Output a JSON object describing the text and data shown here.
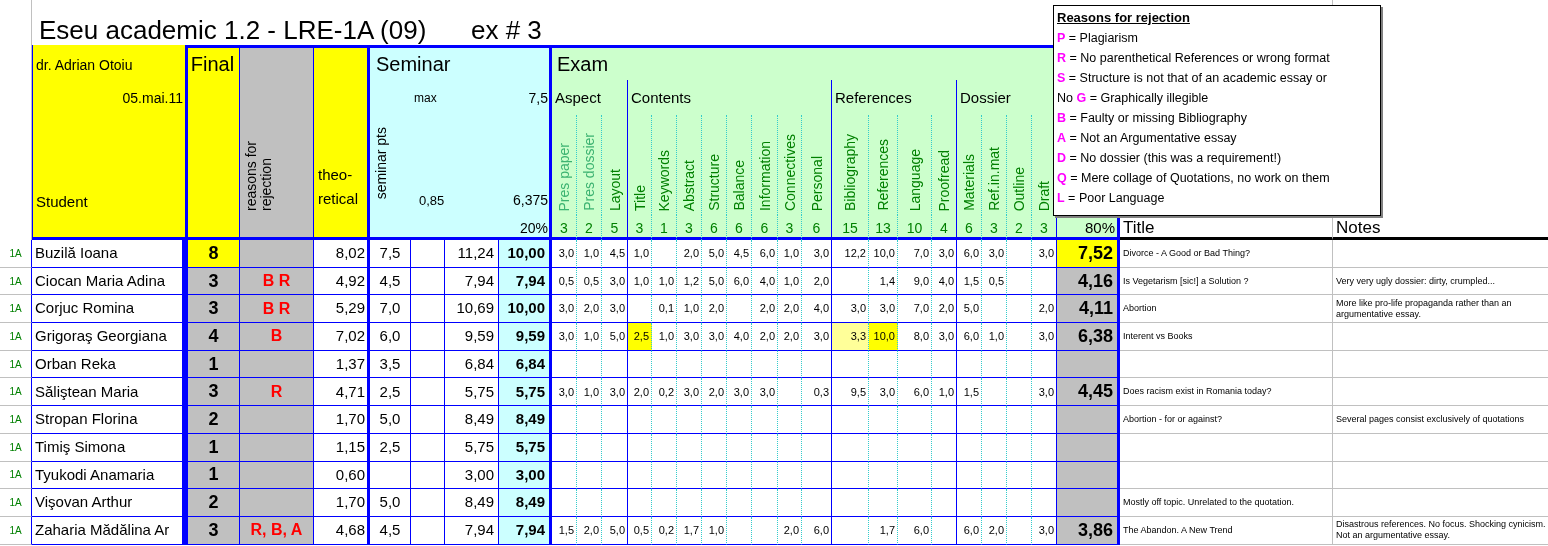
{
  "title": "Eseu academic 1.2 - LRE-1A (09)",
  "exercise": "ex # 3",
  "header": {
    "teacher": "dr. Adrian Otoiu",
    "date": "05.mai.11",
    "student_label": "Student",
    "final_label": "Final",
    "reasons_label": "reasons for rejection",
    "theoretical_label": "theo-retical",
    "title_label": "Title",
    "notes_label": "Notes"
  },
  "seminar": {
    "label": "Seminar",
    "max_label": "max",
    "max": "7,5",
    "pts_label": "seminar pts",
    "factor": "0,85",
    "total": "6,375",
    "weight": "20%"
  },
  "exam": {
    "label": "Exam",
    "weight": "80%",
    "groups": [
      {
        "label": "Aspect",
        "columns": [
          {
            "label": "Pres paper",
            "weight": "3",
            "muted": true
          },
          {
            "label": "Pres dossier",
            "weight": "2",
            "muted": true
          },
          {
            "label": "Layout",
            "weight": "5",
            "muted": false
          }
        ]
      },
      {
        "label": "Contents",
        "columns": [
          {
            "label": "Title",
            "weight": "3",
            "muted": false
          },
          {
            "label": "Keywords",
            "weight": "1",
            "muted": false
          },
          {
            "label": "Abstract",
            "weight": "3",
            "muted": false
          },
          {
            "label": "Structure",
            "weight": "6",
            "muted": false
          },
          {
            "label": "Balance",
            "weight": "6",
            "muted": false
          },
          {
            "label": "Information",
            "weight": "6",
            "muted": false
          },
          {
            "label": "Connectives",
            "weight": "3",
            "muted": false
          },
          {
            "label": "Personal",
            "weight": "6",
            "muted": false
          }
        ]
      },
      {
        "label": "References",
        "columns": [
          {
            "label": "Bibliography",
            "weight": "15",
            "muted": false
          },
          {
            "label": "References",
            "weight": "13",
            "muted": false
          },
          {
            "label": "Language",
            "weight": "10",
            "muted": false
          },
          {
            "label": "Proofread",
            "weight": "4",
            "muted": false
          }
        ]
      },
      {
        "label": "Dossier",
        "columns": [
          {
            "label": "Materials",
            "weight": "6",
            "muted": false
          },
          {
            "label": "Ref.in.mat",
            "weight": "3",
            "muted": false
          },
          {
            "label": "Outline",
            "weight": "2",
            "muted": false
          },
          {
            "label": "Draft",
            "weight": "3",
            "muted": false
          }
        ]
      }
    ]
  },
  "legend": {
    "title": "Reasons for rejection",
    "items": [
      {
        "letter": "P",
        "text": "= Plagiarism"
      },
      {
        "letter": "R",
        "text": "= No parenthetical References or wrong format"
      },
      {
        "letter": "S",
        "text": "= Structure is not that of an academic essay or"
      },
      {
        "prefix": "No",
        "letter": "G",
        "text": "= Graphically illegible"
      },
      {
        "letter": "B",
        "text": "= Faulty or missing Bibliography"
      },
      {
        "letter": "A",
        "text": "= Not an Argumentative essay"
      },
      {
        "letter": "D",
        "text": "= No dossier (this was a requirement!)"
      },
      {
        "letter": "Q",
        "text": "= Mere collage of Quotations, no work on them"
      },
      {
        "letter": "L",
        "text": "= Poor Language"
      }
    ]
  },
  "rows": [
    {
      "group": "1A",
      "name": "Buzilă Ioana",
      "final": "8",
      "passed": true,
      "theoretical": "8,02",
      "seminar_pts": "7,5",
      "seminar_sum": "11,24",
      "seminar": "10,00",
      "exam": [
        {
          "kind": "score",
          "text": "3,0"
        },
        {
          "kind": "score",
          "text": "1,0"
        },
        {
          "kind": "score",
          "text": "4,5"
        },
        {
          "kind": "score",
          "text": "1,0"
        },
        {
          "kind": "blank"
        },
        {
          "kind": "score",
          "text": "2,0"
        },
        {
          "kind": "score",
          "text": "5,0"
        },
        {
          "kind": "score",
          "text": "4,5"
        },
        {
          "kind": "score",
          "text": "6,0"
        },
        {
          "kind": "score",
          "text": "1,0"
        },
        {
          "kind": "score",
          "text": "3,0"
        },
        {
          "kind": "score",
          "text": "12,2"
        },
        {
          "kind": "score",
          "text": "10,0"
        },
        {
          "kind": "score",
          "text": "7,0"
        },
        {
          "kind": "score",
          "text": "3,0"
        },
        {
          "kind": "score",
          "text": "6,0"
        },
        {
          "kind": "score",
          "text": "3,0"
        },
        {
          "kind": "blank"
        },
        {
          "kind": "score",
          "text": "3,0"
        }
      ],
      "total": "7,52",
      "title": "Divorce - A Good or Bad Thing?"
    },
    {
      "group": "1A",
      "name": "Ciocan Maria Adina",
      "final": "3",
      "passed": false,
      "reasons": "B R",
      "theoretical": "4,92",
      "seminar_pts": "4,5",
      "seminar_sum": "7,94",
      "seminar": "7,94",
      "exam": [
        {
          "kind": "score",
          "text": "0,5"
        },
        {
          "kind": "score",
          "text": "0,5"
        },
        {
          "kind": "score",
          "text": "3,0"
        },
        {
          "kind": "score",
          "text": "1,0"
        },
        {
          "kind": "score",
          "text": "1,0"
        },
        {
          "kind": "score",
          "text": "1,2"
        },
        {
          "kind": "score",
          "text": "5,0"
        },
        {
          "kind": "score",
          "text": "6,0"
        },
        {
          "kind": "score",
          "text": "4,0"
        },
        {
          "kind": "score",
          "text": "1,0"
        },
        {
          "kind": "score",
          "text": "2,0"
        },
        {
          "kind": "blank"
        },
        {
          "kind": "score",
          "text": "1,4"
        },
        {
          "kind": "score",
          "text": "9,0"
        },
        {
          "kind": "score",
          "text": "4,0"
        },
        {
          "kind": "score",
          "text": "1,5"
        },
        {
          "kind": "score",
          "text": "0,5"
        },
        {
          "kind": "blank"
        },
        {
          "kind": "blank"
        }
      ],
      "total": "4,16",
      "title": "Is Vegetarism [sic!] a Solution ?",
      "notes": "Very very ugly dossier: dirty, crumpled..."
    },
    {
      "group": "1A",
      "name": "Corjuc Romina",
      "final": "3",
      "passed": false,
      "reasons": "B R",
      "theoretical": "5,29",
      "seminar_pts": "7,0",
      "seminar_sum": "10,69",
      "seminar": "10,00",
      "exam": [
        {
          "kind": "score",
          "text": "3,0"
        },
        {
          "kind": "score",
          "text": "2,0"
        },
        {
          "kind": "score",
          "text": "3,0"
        },
        {
          "kind": "blank"
        },
        {
          "kind": "score",
          "text": "0,1"
        },
        {
          "kind": "score",
          "text": "1,0"
        },
        {
          "kind": "score",
          "text": "2,0"
        },
        {
          "kind": "blank"
        },
        {
          "kind": "score",
          "text": "2,0"
        },
        {
          "kind": "score",
          "text": "2,0"
        },
        {
          "kind": "score",
          "text": "4,0"
        },
        {
          "kind": "score",
          "text": "3,0"
        },
        {
          "kind": "score",
          "text": "3,0"
        },
        {
          "kind": "score",
          "text": "7,0"
        },
        {
          "kind": "score",
          "text": "2,0"
        },
        {
          "kind": "score",
          "text": "5,0"
        },
        {
          "kind": "blank"
        },
        {
          "kind": "blank"
        },
        {
          "kind": "score",
          "text": "2,0"
        }
      ],
      "total": "4,11",
      "title": "Abortion",
      "notes": "More like pro-life propaganda rather than an argumentative essay."
    },
    {
      "group": "1A",
      "name": "Grigoraş Georgiana",
      "final": "4",
      "passed": false,
      "reasons": "B",
      "theoretical": "7,02",
      "seminar_pts": "6,0",
      "seminar_sum": "9,59",
      "seminar": "9,59",
      "exam": [
        {
          "kind": "score",
          "text": "3,0"
        },
        {
          "kind": "score",
          "text": "1,0"
        },
        {
          "kind": "score",
          "text": "5,0"
        },
        {
          "kind": "score",
          "text": "2,5",
          "color": "#ffff00"
        },
        {
          "kind": "score",
          "text": "1,0"
        },
        {
          "kind": "score",
          "text": "3,0"
        },
        {
          "kind": "score",
          "text": "3,0"
        },
        {
          "kind": "score",
          "text": "4,0"
        },
        {
          "kind": "score",
          "text": "2,0"
        },
        {
          "kind": "score",
          "text": "2,0"
        },
        {
          "kind": "score",
          "text": "3,0"
        },
        {
          "kind": "score",
          "text": "3,3",
          "color": "#ffff99"
        },
        {
          "kind": "score",
          "text": "10,0",
          "color": "#ffff00"
        },
        {
          "kind": "score",
          "text": "8,0"
        },
        {
          "kind": "score",
          "text": "3,0"
        },
        {
          "kind": "score",
          "text": "6,0"
        },
        {
          "kind": "score",
          "text": "1,0"
        },
        {
          "kind": "blank"
        },
        {
          "kind": "score",
          "text": "3,0"
        }
      ],
      "total": "6,38",
      "title": "Interent vs Books"
    },
    {
      "group": "1A",
      "name": "Orban Reka",
      "final": "1",
      "passed": false,
      "theoretical": "1,37",
      "seminar_pts": "3,5",
      "seminar_sum": "6,84",
      "seminar": "6,84"
    },
    {
      "group": "1A",
      "name": "Săliştean Maria",
      "final": "3",
      "passed": false,
      "reasons": "R",
      "theoretical": "4,71",
      "seminar_pts": "2,5",
      "seminar_sum": "5,75",
      "seminar": "5,75",
      "exam": [
        {
          "kind": "score",
          "text": "3,0"
        },
        {
          "kind": "score",
          "text": "1,0"
        },
        {
          "kind": "score",
          "text": "3,0"
        },
        {
          "kind": "score",
          "text": "2,0"
        },
        {
          "kind": "score",
          "text": "0,2"
        },
        {
          "kind": "score",
          "text": "3,0"
        },
        {
          "kind": "score",
          "text": "2,0"
        },
        {
          "kind": "score",
          "text": "3,0"
        },
        {
          "kind": "score",
          "text": "3,0"
        },
        {
          "kind": "blank"
        },
        {
          "kind": "score",
          "text": "0,3"
        },
        {
          "kind": "score",
          "text": "9,5"
        },
        {
          "kind": "score",
          "text": "3,0"
        },
        {
          "kind": "score",
          "text": "6,0"
        },
        {
          "kind": "score",
          "text": "1,0"
        },
        {
          "kind": "score",
          "text": "1,5"
        },
        {
          "kind": "blank"
        },
        {
          "kind": "blank"
        },
        {
          "kind": "score",
          "text": "3,0"
        }
      ],
      "total": "4,45",
      "title": "Does racism exist in Romania today?"
    },
    {
      "group": "1A",
      "name": "Stropan Florina",
      "final": "2",
      "passed": false,
      "theoretical": "1,70",
      "seminar_pts": "5,0",
      "seminar_sum": "8,49",
      "seminar": "8,49",
      "title": "Abortion - for or against?",
      "notes": "Several pages consist exclusively of quotations"
    },
    {
      "group": "1A",
      "name": "Timiş Simona",
      "final": "1",
      "passed": false,
      "theoretical": "1,15",
      "seminar_pts": "2,5",
      "seminar_sum": "5,75",
      "seminar": "5,75"
    },
    {
      "group": "1A",
      "name": "Tyukodi Anamaria",
      "final": "1",
      "passed": false,
      "theoretical": "0,60",
      "seminar_sum": "3,00",
      "seminar": "3,00"
    },
    {
      "group": "1A",
      "name": "Vişovan Arthur",
      "final": "2",
      "passed": false,
      "theoretical": "1,70",
      "seminar_pts": "5,0",
      "seminar_sum": "8,49",
      "seminar": "8,49",
      "title": "Mostly off topic. Unrelated to the quotation."
    },
    {
      "group": "1A",
      "name": "Zaharia Mădălina Ar",
      "final": "3",
      "passed": false,
      "reasons": "R, B, A",
      "theoretical": "4,68",
      "seminar_pts": "4,5",
      "seminar_sum": "7,94",
      "seminar": "7,94",
      "exam": [
        {
          "kind": "score",
          "text": "1,5"
        },
        {
          "kind": "score",
          "text": "2,0"
        },
        {
          "kind": "score",
          "text": "5,0"
        },
        {
          "kind": "score",
          "text": "0,5"
        },
        {
          "kind": "score",
          "text": "0,2"
        },
        {
          "kind": "score",
          "text": "1,7"
        },
        {
          "kind": "score",
          "text": "1,0"
        },
        {
          "kind": "blank"
        },
        {
          "kind": "blank"
        },
        {
          "kind": "score",
          "text": "2,0"
        },
        {
          "kind": "score",
          "text": "6,0"
        },
        {
          "kind": "blank"
        },
        {
          "kind": "score",
          "text": "1,7"
        },
        {
          "kind": "score",
          "text": "6,0"
        },
        {
          "kind": "blank"
        },
        {
          "kind": "score",
          "text": "6,0"
        },
        {
          "kind": "score",
          "text": "2,0"
        },
        {
          "kind": "blank"
        },
        {
          "kind": "score",
          "text": "3,0"
        }
      ],
      "total": "3,86",
      "title": "The Abandon. A New Trend",
      "notes": "Disastrous references. No focus. Shocking cynicism. Not an argumentative essay."
    }
  ]
}
